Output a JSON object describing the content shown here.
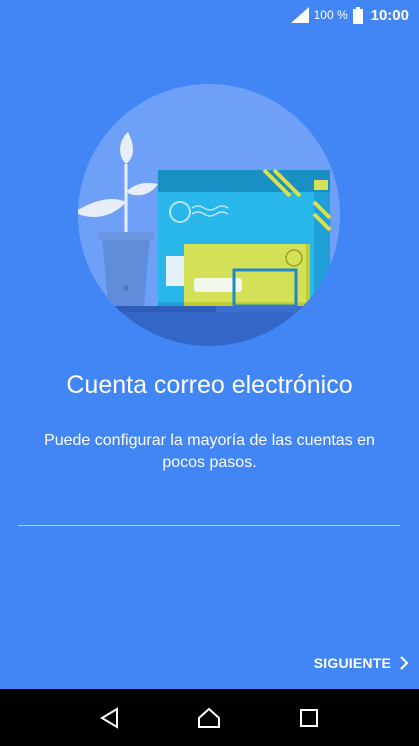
{
  "status_bar": {
    "battery": "100 %",
    "time": "10:00"
  },
  "content": {
    "title": "Cuenta correo electrónico",
    "subtitle": "Puede configurar la mayoría de las cuentas en pocos pasos."
  },
  "actions": {
    "next_label": "SIGUIENTE"
  },
  "icons": {
    "signal": "signal-icon",
    "battery": "battery-icon",
    "next": "chevron-right-icon",
    "back": "back-icon",
    "home": "home-icon",
    "recents": "recents-icon"
  },
  "colors": {
    "background": "#4285F4",
    "circle": "#6FA0F7",
    "envelope_cyan": "#29B6E8",
    "envelope_yellow": "#D4E157",
    "nav_bar": "#000000"
  }
}
